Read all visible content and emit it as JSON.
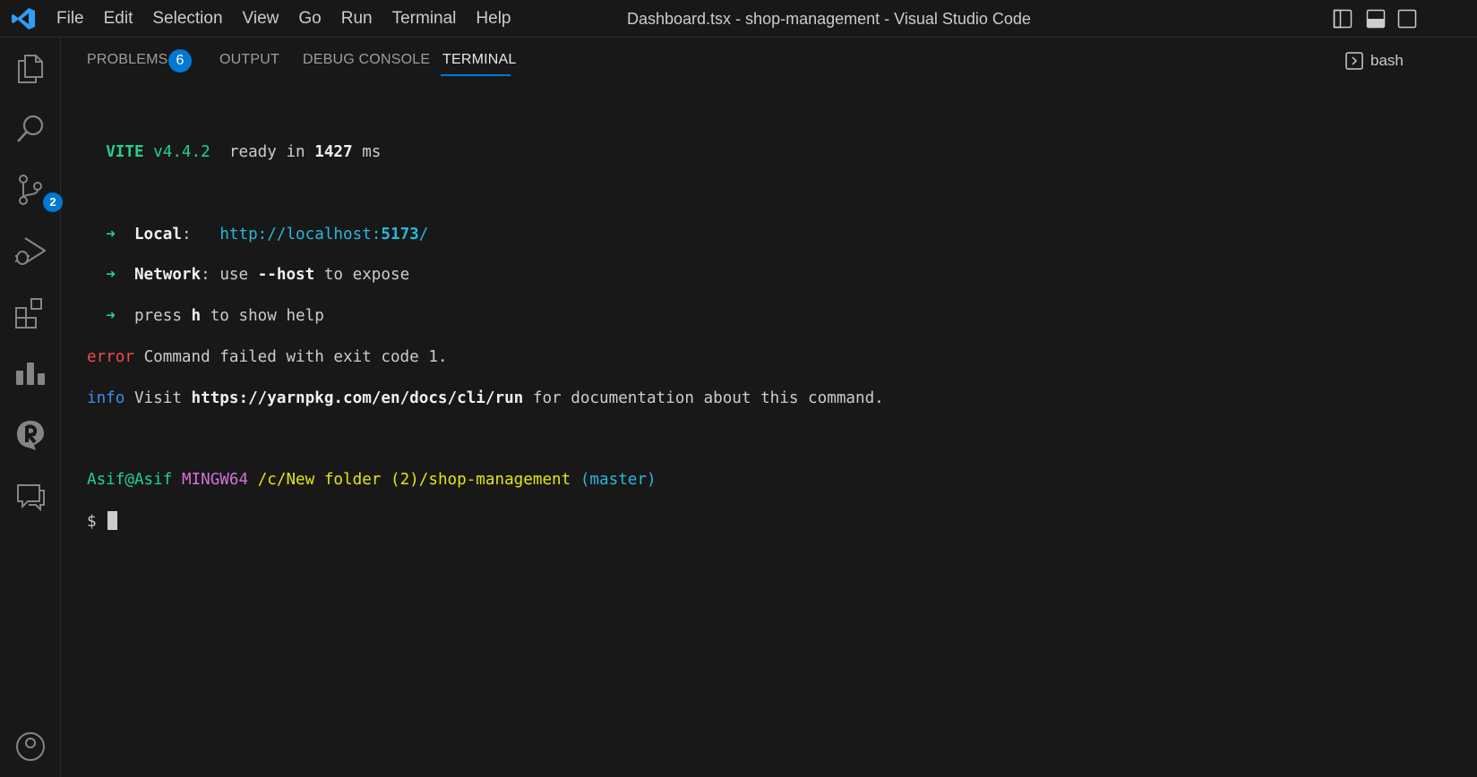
{
  "titlebar": {
    "menu": [
      "File",
      "Edit",
      "Selection",
      "View",
      "Go",
      "Run",
      "Terminal",
      "Help"
    ],
    "title": "Dashboard.tsx - shop-management - Visual Studio Code",
    "logo_icon": "vscode-logo-icon",
    "layout_icons": [
      "toggle-primary-sidebar-icon",
      "toggle-panel-icon",
      "toggle-secondary-sidebar-icon"
    ]
  },
  "activitybar": {
    "items": [
      {
        "name": "explorer",
        "icon": "files-icon"
      },
      {
        "name": "search",
        "icon": "search-icon"
      },
      {
        "name": "source-control",
        "icon": "source-control-icon",
        "badge": "2"
      },
      {
        "name": "run-and-debug",
        "icon": "run-debug-icon"
      },
      {
        "name": "extensions",
        "icon": "extensions-icon"
      },
      {
        "name": "charts",
        "icon": "bar-chart-icon"
      },
      {
        "name": "quokka",
        "icon": "quokka-icon"
      },
      {
        "name": "comments",
        "icon": "comments-icon"
      }
    ]
  },
  "panel": {
    "tabs": {
      "problems": "PROBLEMS",
      "problems_count": "6",
      "output": "OUTPUT",
      "debug_console": "DEBUG CONSOLE",
      "terminal": "TERMINAL"
    },
    "terminal_name": "bash",
    "active_tab": "TERMINAL"
  },
  "terminal": {
    "vite_name": "VITE",
    "vite_version": "v4.4.2",
    "ready_text": "ready in",
    "ready_ms": "1427",
    "ms": "ms",
    "arrow": "➜",
    "local_label": "Local",
    "local_url_prefix": "http://localhost:",
    "local_port": "5173",
    "local_url_suffix": "/",
    "network_label": "Network",
    "network_use": "use",
    "network_flag": "--host",
    "network_rest": "to expose",
    "press": "press",
    "press_key": "h",
    "press_rest": "to show help",
    "error_tag": "error",
    "error_msg": "Command failed with exit code 1.",
    "info_tag": "info",
    "info_visit": "Visit",
    "info_url": "https://yarnpkg.com/en/docs/cli/run",
    "info_rest": "for documentation about this command.",
    "prompt_user": "Asif@Asif",
    "prompt_host": "MINGW64",
    "prompt_path": "/c/New folder (2)/shop-management",
    "prompt_branch": "(master)",
    "prompt_symbol": "$"
  }
}
